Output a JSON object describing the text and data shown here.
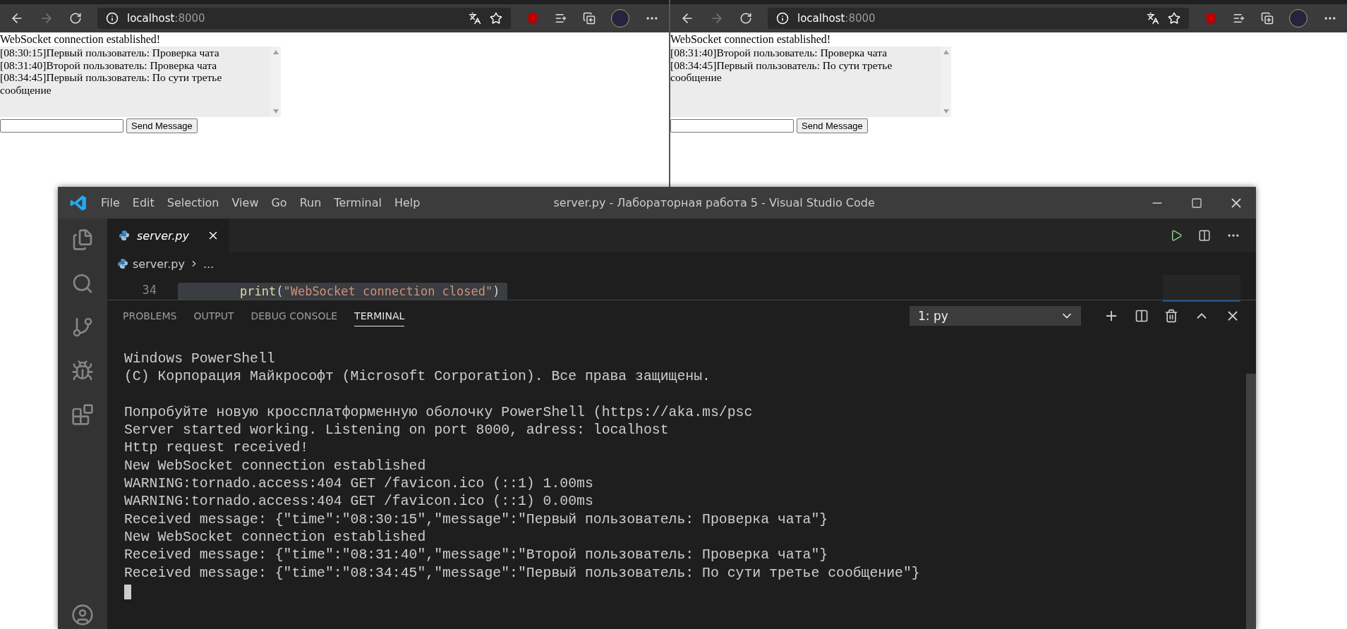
{
  "browsers": [
    {
      "address_host": "localhost",
      "address_port": ":8000",
      "status": "WebSocket connection established!",
      "messages": [
        "[08:30:15]Первый пользователь: Проверка чата",
        "[08:31:40]Второй пользователь: Проверка чата",
        "[08:34:45]Первый пользователь: По сути третье сообщение"
      ],
      "send_button": "Send Message"
    },
    {
      "address_host": "localhost",
      "address_port": ":8000",
      "status": "WebSocket connection established!",
      "messages": [
        "[08:31:40]Второй пользователь: Проверка чата",
        "[08:34:45]Первый пользователь: По сути третье сообщение"
      ],
      "send_button": "Send Message"
    }
  ],
  "vscode": {
    "menu": [
      "File",
      "Edit",
      "Selection",
      "View",
      "Go",
      "Run",
      "Terminal",
      "Help"
    ],
    "title": "server.py - Лабораторная работа 5 - Visual Studio Code",
    "tabs": [
      {
        "label": "server.py",
        "selected": true
      }
    ],
    "breadcrumb": [
      "server.py",
      "..."
    ],
    "code_lines": [
      {
        "number": "34",
        "tokens": [
          {
            "kind": "function",
            "text": "print"
          },
          {
            "kind": "punct",
            "text": "("
          },
          {
            "kind": "string",
            "text": "\"WebSocket connection closed\""
          },
          {
            "kind": "punct",
            "text": ")"
          }
        ]
      }
    ],
    "panel_tabs": [
      {
        "label": "PROBLEMS",
        "selected": false
      },
      {
        "label": "OUTPUT",
        "selected": false
      },
      {
        "label": "DEBUG CONSOLE",
        "selected": false
      },
      {
        "label": "TERMINAL",
        "selected": true
      }
    ],
    "terminal_selector": "1: py",
    "terminal_blocks": [
      [
        "Windows PowerShell",
        "(C) Корпорация Майкрософт (Microsoft Corporation). Все права защищены."
      ],
      [
        "Попробуйте новую кроссплатформенную оболочку PowerShell (https://aka.ms/psc",
        "Server started working. Listening on port 8000, adress: localhost",
        "Http request received!",
        "New WebSocket connection established",
        "WARNING:tornado.access:404 GET /favicon.ico (::1) 1.00ms",
        "WARNING:tornado.access:404 GET /favicon.ico (::1) 0.00ms",
        "Received message: {\"time\":\"08:30:15\",\"message\":\"Первый пользователь: Проверка чата\"}",
        "New WebSocket connection established",
        "Received message: {\"time\":\"08:31:40\",\"message\":\"Второй пользователь: Проверка чата\"}",
        "Received message: {\"time\":\"08:34:45\",\"message\":\"Первый пользователь: По сути третье сообщение\"}"
      ]
    ]
  }
}
